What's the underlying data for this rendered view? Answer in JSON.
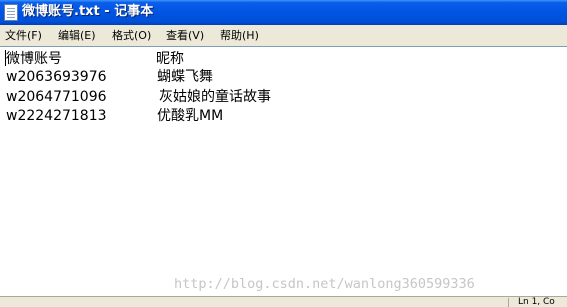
{
  "window": {
    "title": "微博账号.txt - 记事本"
  },
  "menu": {
    "items": [
      {
        "label": "文件(F)"
      },
      {
        "label": "编辑(E)"
      },
      {
        "label": "格式(O)"
      },
      {
        "label": "查看(V)"
      },
      {
        "label": "帮助(H)"
      }
    ]
  },
  "content": {
    "header": {
      "account": "微博账号",
      "nickname": "昵称"
    },
    "rows": [
      {
        "account": "w2063693976",
        "nickname": "蝴蝶飞舞"
      },
      {
        "account": "w2064771096",
        "nickname": "灰姑娘的童话故事"
      },
      {
        "account": "w2224271813",
        "nickname": "优酸乳MM"
      }
    ]
  },
  "watermark": "http://blog.csdn.net/wanlong360599336",
  "status": {
    "position": "Ln 1, Co"
  },
  "icons": {
    "app": "notepad-icon"
  }
}
